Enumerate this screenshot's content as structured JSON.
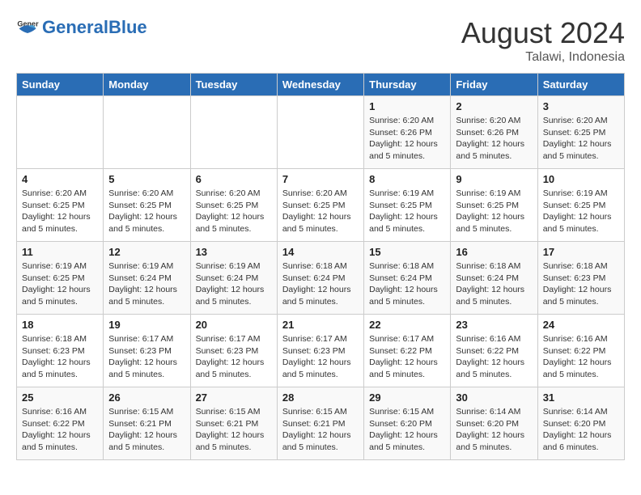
{
  "header": {
    "logo_general": "General",
    "logo_blue": "Blue",
    "month_year": "August 2024",
    "location": "Talawi, Indonesia"
  },
  "days_of_week": [
    "Sunday",
    "Monday",
    "Tuesday",
    "Wednesday",
    "Thursday",
    "Friday",
    "Saturday"
  ],
  "weeks": [
    [
      {
        "day": "",
        "sunrise": "",
        "sunset": "",
        "daylight": ""
      },
      {
        "day": "",
        "sunrise": "",
        "sunset": "",
        "daylight": ""
      },
      {
        "day": "",
        "sunrise": "",
        "sunset": "",
        "daylight": ""
      },
      {
        "day": "",
        "sunrise": "",
        "sunset": "",
        "daylight": ""
      },
      {
        "day": "1",
        "sunrise": "Sunrise: 6:20 AM",
        "sunset": "Sunset: 6:26 PM",
        "daylight": "Daylight: 12 hours and 5 minutes."
      },
      {
        "day": "2",
        "sunrise": "Sunrise: 6:20 AM",
        "sunset": "Sunset: 6:26 PM",
        "daylight": "Daylight: 12 hours and 5 minutes."
      },
      {
        "day": "3",
        "sunrise": "Sunrise: 6:20 AM",
        "sunset": "Sunset: 6:25 PM",
        "daylight": "Daylight: 12 hours and 5 minutes."
      }
    ],
    [
      {
        "day": "4",
        "sunrise": "Sunrise: 6:20 AM",
        "sunset": "Sunset: 6:25 PM",
        "daylight": "Daylight: 12 hours and 5 minutes."
      },
      {
        "day": "5",
        "sunrise": "Sunrise: 6:20 AM",
        "sunset": "Sunset: 6:25 PM",
        "daylight": "Daylight: 12 hours and 5 minutes."
      },
      {
        "day": "6",
        "sunrise": "Sunrise: 6:20 AM",
        "sunset": "Sunset: 6:25 PM",
        "daylight": "Daylight: 12 hours and 5 minutes."
      },
      {
        "day": "7",
        "sunrise": "Sunrise: 6:20 AM",
        "sunset": "Sunset: 6:25 PM",
        "daylight": "Daylight: 12 hours and 5 minutes."
      },
      {
        "day": "8",
        "sunrise": "Sunrise: 6:19 AM",
        "sunset": "Sunset: 6:25 PM",
        "daylight": "Daylight: 12 hours and 5 minutes."
      },
      {
        "day": "9",
        "sunrise": "Sunrise: 6:19 AM",
        "sunset": "Sunset: 6:25 PM",
        "daylight": "Daylight: 12 hours and 5 minutes."
      },
      {
        "day": "10",
        "sunrise": "Sunrise: 6:19 AM",
        "sunset": "Sunset: 6:25 PM",
        "daylight": "Daylight: 12 hours and 5 minutes."
      }
    ],
    [
      {
        "day": "11",
        "sunrise": "Sunrise: 6:19 AM",
        "sunset": "Sunset: 6:25 PM",
        "daylight": "Daylight: 12 hours and 5 minutes."
      },
      {
        "day": "12",
        "sunrise": "Sunrise: 6:19 AM",
        "sunset": "Sunset: 6:24 PM",
        "daylight": "Daylight: 12 hours and 5 minutes."
      },
      {
        "day": "13",
        "sunrise": "Sunrise: 6:19 AM",
        "sunset": "Sunset: 6:24 PM",
        "daylight": "Daylight: 12 hours and 5 minutes."
      },
      {
        "day": "14",
        "sunrise": "Sunrise: 6:18 AM",
        "sunset": "Sunset: 6:24 PM",
        "daylight": "Daylight: 12 hours and 5 minutes."
      },
      {
        "day": "15",
        "sunrise": "Sunrise: 6:18 AM",
        "sunset": "Sunset: 6:24 PM",
        "daylight": "Daylight: 12 hours and 5 minutes."
      },
      {
        "day": "16",
        "sunrise": "Sunrise: 6:18 AM",
        "sunset": "Sunset: 6:24 PM",
        "daylight": "Daylight: 12 hours and 5 minutes."
      },
      {
        "day": "17",
        "sunrise": "Sunrise: 6:18 AM",
        "sunset": "Sunset: 6:23 PM",
        "daylight": "Daylight: 12 hours and 5 minutes."
      }
    ],
    [
      {
        "day": "18",
        "sunrise": "Sunrise: 6:18 AM",
        "sunset": "Sunset: 6:23 PM",
        "daylight": "Daylight: 12 hours and 5 minutes."
      },
      {
        "day": "19",
        "sunrise": "Sunrise: 6:17 AM",
        "sunset": "Sunset: 6:23 PM",
        "daylight": "Daylight: 12 hours and 5 minutes."
      },
      {
        "day": "20",
        "sunrise": "Sunrise: 6:17 AM",
        "sunset": "Sunset: 6:23 PM",
        "daylight": "Daylight: 12 hours and 5 minutes."
      },
      {
        "day": "21",
        "sunrise": "Sunrise: 6:17 AM",
        "sunset": "Sunset: 6:23 PM",
        "daylight": "Daylight: 12 hours and 5 minutes."
      },
      {
        "day": "22",
        "sunrise": "Sunrise: 6:17 AM",
        "sunset": "Sunset: 6:22 PM",
        "daylight": "Daylight: 12 hours and 5 minutes."
      },
      {
        "day": "23",
        "sunrise": "Sunrise: 6:16 AM",
        "sunset": "Sunset: 6:22 PM",
        "daylight": "Daylight: 12 hours and 5 minutes."
      },
      {
        "day": "24",
        "sunrise": "Sunrise: 6:16 AM",
        "sunset": "Sunset: 6:22 PM",
        "daylight": "Daylight: 12 hours and 5 minutes."
      }
    ],
    [
      {
        "day": "25",
        "sunrise": "Sunrise: 6:16 AM",
        "sunset": "Sunset: 6:22 PM",
        "daylight": "Daylight: 12 hours and 5 minutes."
      },
      {
        "day": "26",
        "sunrise": "Sunrise: 6:15 AM",
        "sunset": "Sunset: 6:21 PM",
        "daylight": "Daylight: 12 hours and 5 minutes."
      },
      {
        "day": "27",
        "sunrise": "Sunrise: 6:15 AM",
        "sunset": "Sunset: 6:21 PM",
        "daylight": "Daylight: 12 hours and 5 minutes."
      },
      {
        "day": "28",
        "sunrise": "Sunrise: 6:15 AM",
        "sunset": "Sunset: 6:21 PM",
        "daylight": "Daylight: 12 hours and 5 minutes."
      },
      {
        "day": "29",
        "sunrise": "Sunrise: 6:15 AM",
        "sunset": "Sunset: 6:20 PM",
        "daylight": "Daylight: 12 hours and 5 minutes."
      },
      {
        "day": "30",
        "sunrise": "Sunrise: 6:14 AM",
        "sunset": "Sunset: 6:20 PM",
        "daylight": "Daylight: 12 hours and 5 minutes."
      },
      {
        "day": "31",
        "sunrise": "Sunrise: 6:14 AM",
        "sunset": "Sunset: 6:20 PM",
        "daylight": "Daylight: 12 hours and 6 minutes."
      }
    ]
  ]
}
